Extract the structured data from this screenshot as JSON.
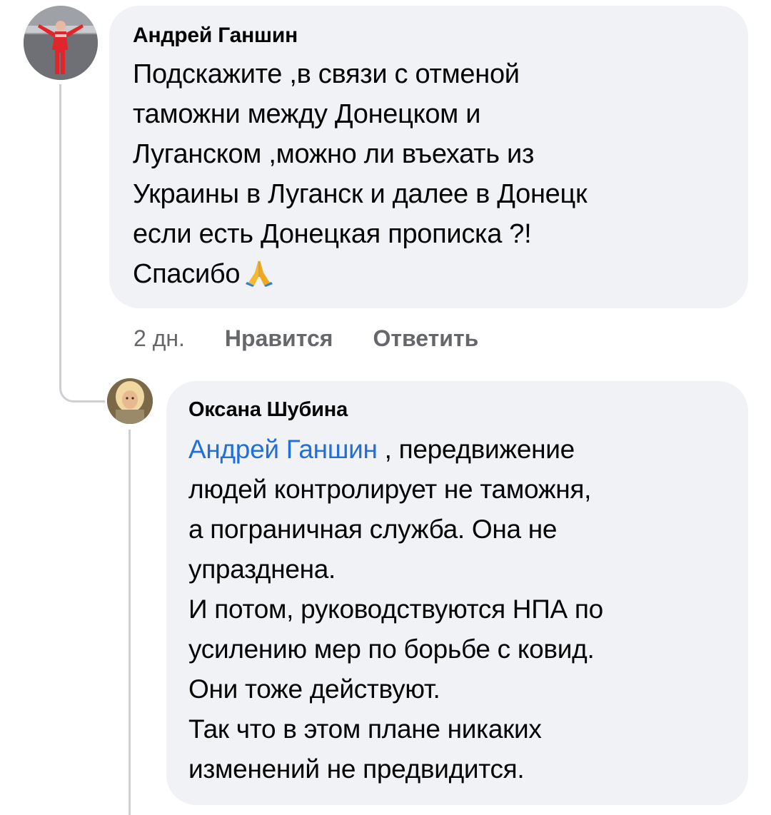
{
  "comments": [
    {
      "author": "Андрей Ганшин",
      "text_lines": [
        "Подскажите ,в связи с отменой",
        "таможни между Донецком и",
        "Луганском ,можно ли въехать из",
        "Украины в Луганск и далее в Донецк",
        "если есть Донецкая прописка ?!",
        "Спасибо"
      ],
      "emoji": "folded-hands-icon",
      "time": "2 дн.",
      "like_label": "Нравится",
      "reply_label": "Ответить"
    }
  ],
  "reply": {
    "author": "Оксана Шубина",
    "mention": "Андрей Ганшин",
    "first_line_rest": " , передвижение",
    "text_lines": [
      "людей контролирует не таможня,",
      "а пограничная служба. Она не",
      "упразднена.",
      "И потом, руководствуются НПА по",
      "усилению мер по борьбе с ковид.",
      "Они тоже действуют.",
      "Так что в этом плане никаких",
      "изменений не предвидится."
    ]
  },
  "colors": {
    "bubble": "#f0f2f5",
    "mention": "#216fdb",
    "secondary_text": "#65676b",
    "thread_line": "#ced0d4"
  }
}
